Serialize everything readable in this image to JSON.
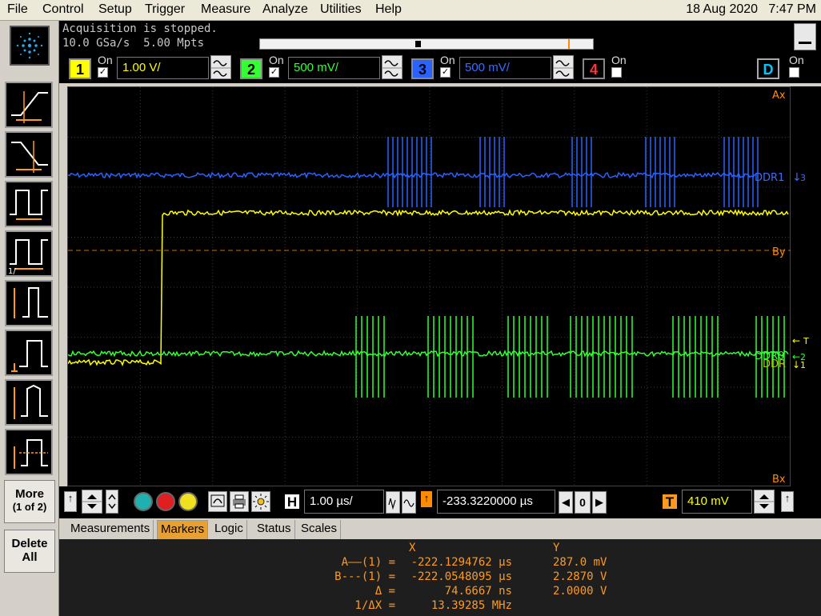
{
  "menu": [
    "File",
    "Control",
    "Setup",
    "Trigger",
    "Measure",
    "Analyze",
    "Utilities",
    "Help"
  ],
  "datetime": {
    "date": "18 Aug 2020",
    "time": "7:47 PM"
  },
  "status": {
    "acquisition": "Acquisition is stopped.",
    "sample_rate": "10.0 GSa/s",
    "memory_depth": "5.00 Mpts"
  },
  "channels": [
    {
      "num": "1",
      "on_label": "On",
      "checked": "✓",
      "scale": "1.00 V/",
      "color": "#ffff00"
    },
    {
      "num": "2",
      "on_label": "On",
      "checked": "✓",
      "scale": "500 mV/",
      "color": "#33ff33"
    },
    {
      "num": "3",
      "on_label": "On",
      "checked": "✓",
      "scale": "500 mV/",
      "color": "#3a6cff"
    },
    {
      "num": "4",
      "on_label": "On",
      "checked": "",
      "scale": "",
      "color": "#ff3333"
    },
    {
      "num": "D",
      "on_label": "On",
      "checked": "",
      "scale": "",
      "color": "#00c8ff"
    }
  ],
  "waveform": {
    "marker_labels": {
      "ax": "Ax",
      "by": "By",
      "bx": "Bx"
    },
    "trace_labels": {
      "ddr1": "DDR1",
      "ddr0": "DDR0",
      "ddr0_ghost": "DDR",
      "ch3_ref": "3",
      "ch2_ref": "2",
      "ch1_ref": "1",
      "trig_mark": "T"
    },
    "colors": {
      "ch1": "#ffff00",
      "ch2": "#33ff33",
      "ch3": "#2b62ff",
      "marker": "#ff8c00",
      "grid": "#3a3a3a"
    }
  },
  "side_buttons": {
    "more": "More",
    "page": "(1 of 2)",
    "delete": "Delete",
    "all": "All"
  },
  "hcontrols": {
    "h_label": "H",
    "timebase": "1.00 µs/",
    "delay": "-233.3220000 µs",
    "zero": "0",
    "t_label": "T",
    "trigger_level": "410 mV"
  },
  "tabs": [
    "Measurements",
    "Markers",
    "Logic",
    "Status",
    "Scales"
  ],
  "markers": {
    "header_x": "X",
    "header_y": "Y",
    "rows": [
      {
        "label": "A——(1) =",
        "x": "-222.1294762 µs",
        "y": "287.0 mV"
      },
      {
        "label": "B---(1) =",
        "x": "-222.0548095 µs",
        "y": "2.2870 V"
      },
      {
        "label": "Δ =",
        "x": "74.6667 ns",
        "y": "2.0000 V"
      },
      {
        "label": "1/ΔX =",
        "x": "13.39285 MHz",
        "y": ""
      }
    ]
  }
}
